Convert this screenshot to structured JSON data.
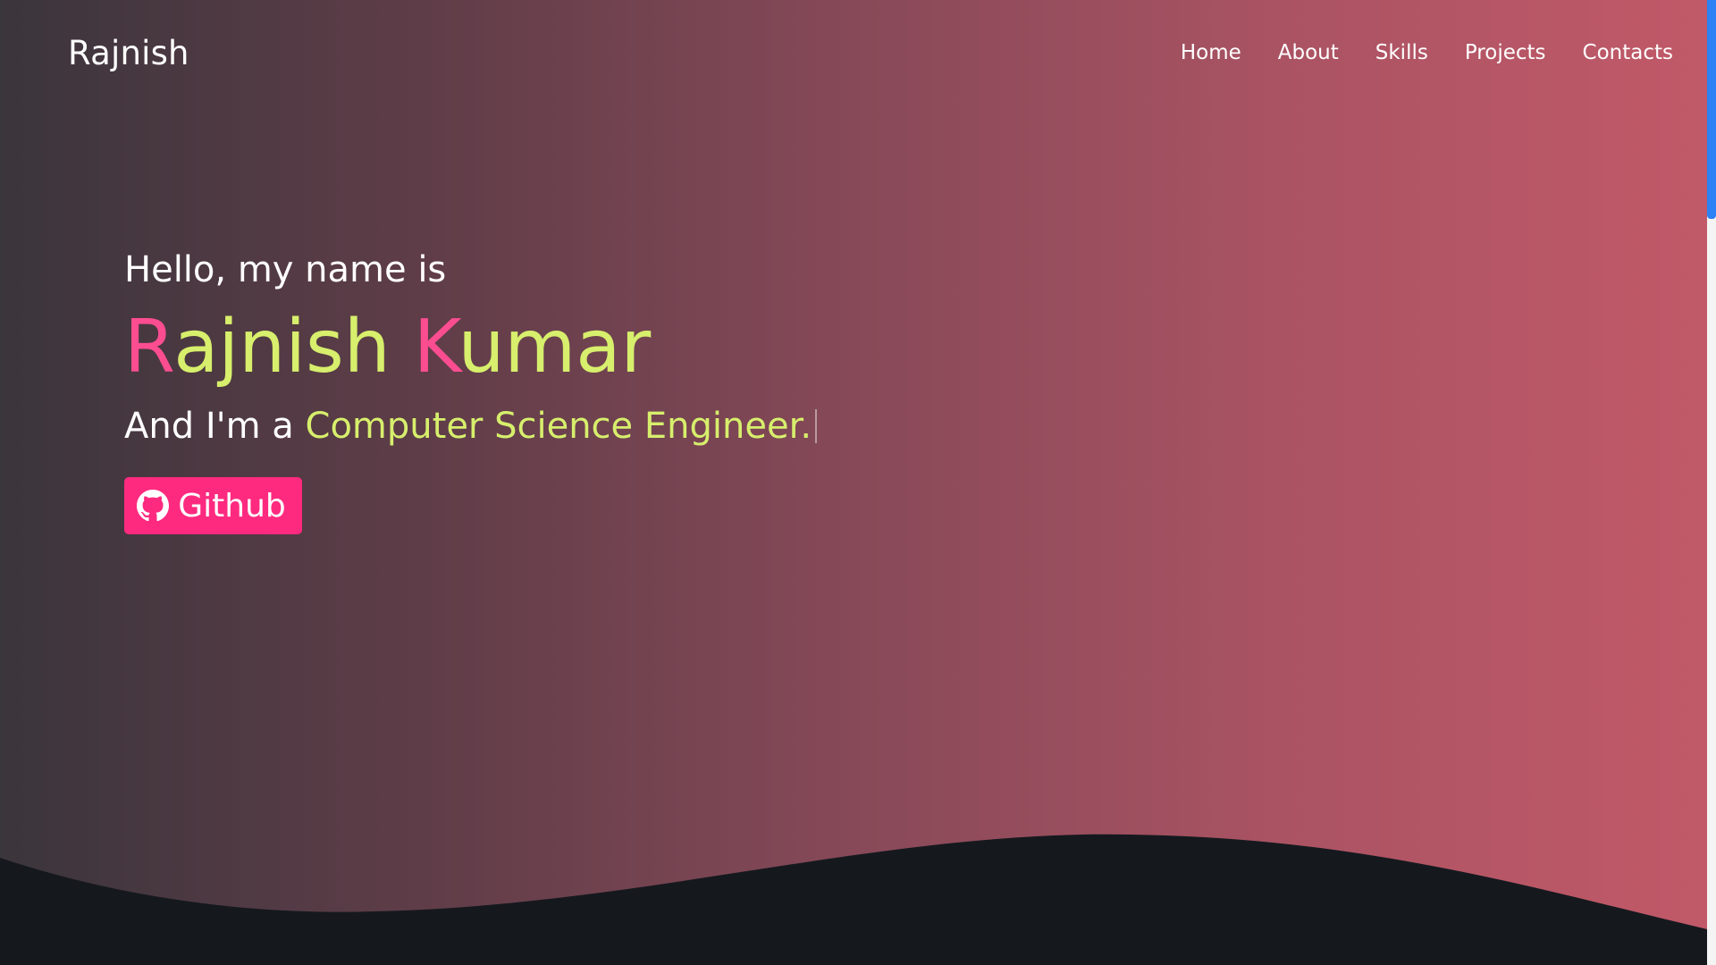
{
  "navbar": {
    "logo": "Rajnish",
    "links": [
      "Home",
      "About",
      "Skills",
      "Projects",
      "Contacts"
    ]
  },
  "hero": {
    "greeting": "Hello, my name is",
    "name": {
      "first_initial": "R",
      "first_rest": "ajnish",
      "last_initial": "K",
      "last_rest": "umar"
    },
    "role_prefix": "And I'm a",
    "role": "Computer Science Engineer."
  },
  "github_button": {
    "label": "Github",
    "icon": "github-icon"
  },
  "colors": {
    "accent_pink": "#fe2a7f",
    "name_initial": "#fc4d91",
    "highlight_green": "#d7ef6c",
    "wave_dark": "#15191e",
    "scrollbar_thumb": "#2c81f4"
  }
}
